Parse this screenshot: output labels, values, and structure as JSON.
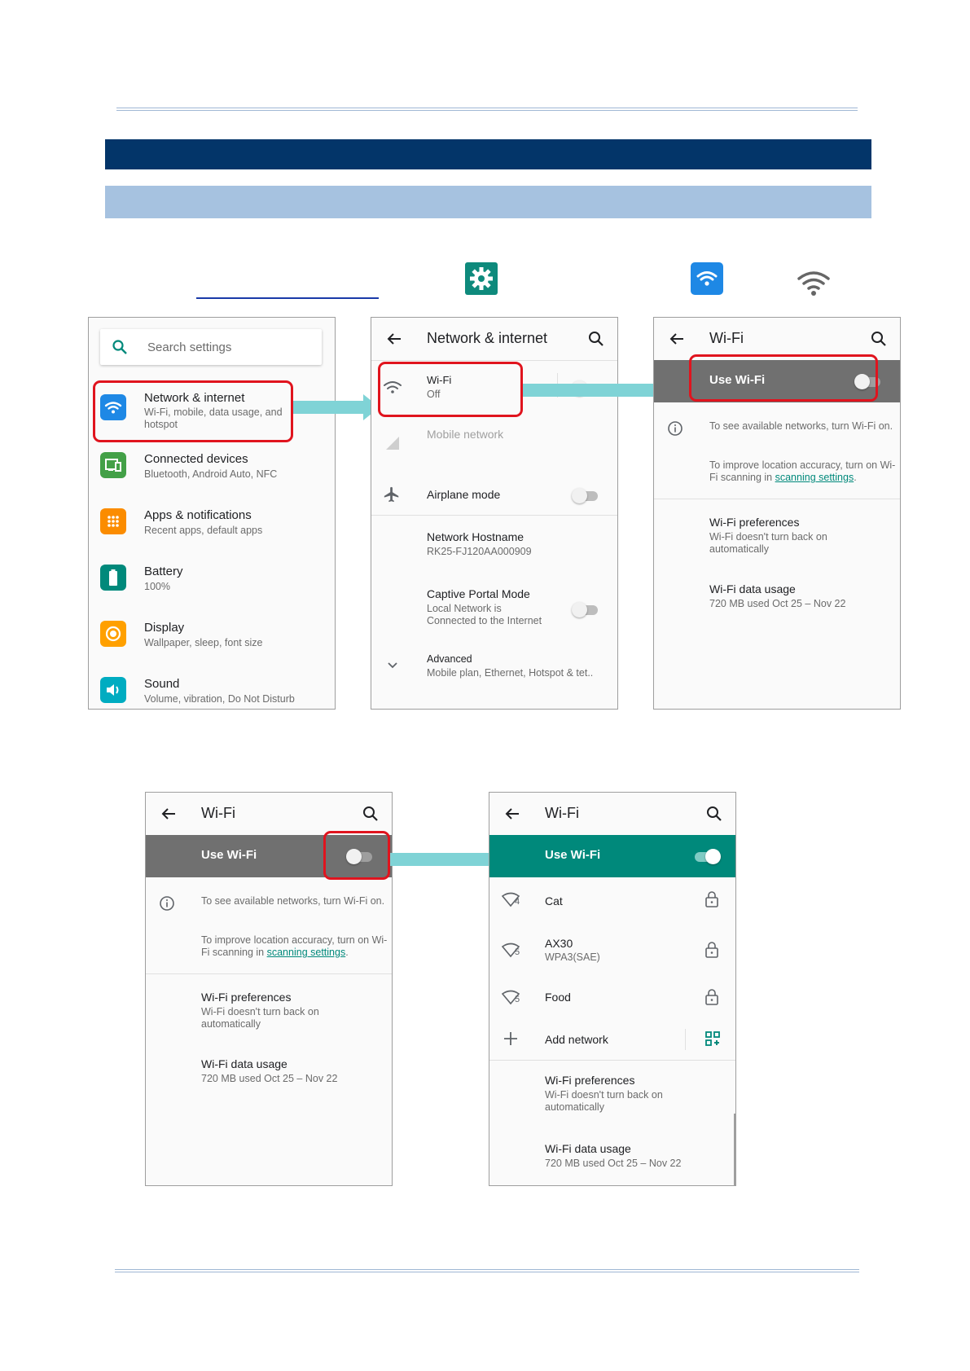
{
  "screen1": {
    "search_placeholder": "Search settings",
    "items": [
      {
        "title": "Network & internet",
        "subtitle": "Wi-Fi, mobile, data usage, and hotspot",
        "icon": "wifi-icon",
        "color": "#1e88e5"
      },
      {
        "title": "Connected devices",
        "subtitle": "Bluetooth, Android Auto, NFC",
        "icon": "devices-icon",
        "color": "#43a047"
      },
      {
        "title": "Apps & notifications",
        "subtitle": "Recent apps, default apps",
        "icon": "apps-icon",
        "color": "#fb8c00"
      },
      {
        "title": "Battery",
        "subtitle": "100%",
        "icon": "battery-icon",
        "color": "#00897b"
      },
      {
        "title": "Display",
        "subtitle": "Wallpaper, sleep, font size",
        "icon": "display-icon",
        "color": "#ffa000"
      },
      {
        "title": "Sound",
        "subtitle": "Volume, vibration, Do Not Disturb",
        "icon": "sound-icon",
        "color": "#00acc1"
      }
    ]
  },
  "screen2": {
    "title": "Network & internet",
    "wifi": {
      "title": "Wi-Fi",
      "subtitle": "Off"
    },
    "mobile": {
      "title": "Mobile network"
    },
    "airplane": {
      "title": "Airplane mode"
    },
    "hostname": {
      "title": "Network Hostname",
      "subtitle": "RK25-FJ120AA000909"
    },
    "captive": {
      "title": "Captive Portal Mode",
      "subtitle1": "Local Network is",
      "subtitle2": "Connected to the Internet"
    },
    "advanced": {
      "title": "Advanced",
      "subtitle": "Mobile plan, Ethernet, Hotspot & tet.."
    }
  },
  "wifi_off": {
    "title": "Wi-Fi",
    "use_wifi": "Use Wi-Fi",
    "info1": "To see available networks, turn Wi-Fi on.",
    "info2_prefix": "To improve location accuracy, turn on Wi-Fi scanning in ",
    "info2_link": "scanning settings",
    "info2_suffix": ".",
    "prefs_title": "Wi-Fi preferences",
    "prefs_subtitle": "Wi-Fi doesn't turn back on automatically",
    "usage_title": "Wi-Fi data usage",
    "usage_subtitle": "720 MB used Oct 25 – Nov 22"
  },
  "wifi_on": {
    "title": "Wi-Fi",
    "use_wifi": "Use Wi-Fi",
    "networks": [
      {
        "name": "Cat",
        "detail": "",
        "signal": "4"
      },
      {
        "name": "AX30",
        "detail": "WPA3(SAE)",
        "signal": "5"
      },
      {
        "name": "Food",
        "detail": "",
        "signal": "5"
      }
    ],
    "add_network": "Add network",
    "prefs_title": "Wi-Fi preferences",
    "prefs_subtitle": "Wi-Fi doesn't turn back on automatically",
    "usage_title": "Wi-Fi data usage",
    "usage_subtitle": "720 MB used Oct 25 – Nov 22"
  },
  "colors": {
    "dark_band": "#033569",
    "light_band": "#a6c2e0",
    "teal": "#00897b",
    "gray_bar": "#707070",
    "highlight": "#e0141e",
    "arrow": "#7fd3d6"
  }
}
